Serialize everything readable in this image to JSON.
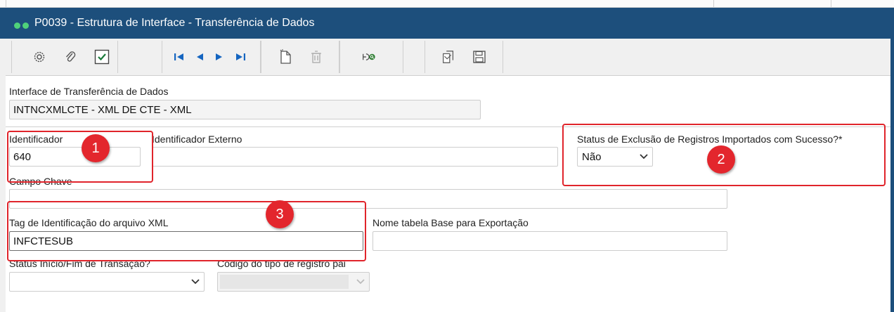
{
  "window": {
    "title": "P0039 - Estrutura de Interface - Transferência de Dados"
  },
  "toolbar": {
    "icons": [
      "gear-icon",
      "paperclip-icon",
      "check-icon",
      "first-record-icon",
      "previous-record-icon",
      "next-record-icon",
      "last-record-icon",
      "new-document-icon",
      "trash-icon",
      "search-record-icon",
      "copy-icon",
      "save-icon"
    ]
  },
  "form": {
    "interface": {
      "label": "Interface de Transferência de Dados",
      "value": "INTNCXMLCTE - XML DE CTE - XML"
    },
    "identificador": {
      "label": "Identificador",
      "value": "640"
    },
    "identificador_externo": {
      "label": "Identificador Externo",
      "value": ""
    },
    "status_exclusao": {
      "label": "Status de Exclusão de Registros Importados com Sucesso?*",
      "selected": "Não"
    },
    "campo_chave": {
      "label": "Campo Chave",
      "value": ""
    },
    "tag_xml": {
      "label": "Tag de Identificação do arquivo XML",
      "value": "INFCTESUB"
    },
    "nome_tabela": {
      "label": "Nome tabela Base para Exportação",
      "value": ""
    },
    "status_transacao": {
      "label": "Status Início/Fim de Transação?",
      "selected": ""
    },
    "codigo_tipo_registro": {
      "label": "Código do tipo de registro pai",
      "selected": ""
    }
  },
  "annotations": {
    "badge1": "1",
    "badge2": "2",
    "badge3": "3",
    "color": "#e3262d"
  },
  "colors": {
    "titlebar": "#1d4f7c",
    "toolbar_icon_blue": "#1565c0",
    "status_dots": "#4fd17a"
  }
}
